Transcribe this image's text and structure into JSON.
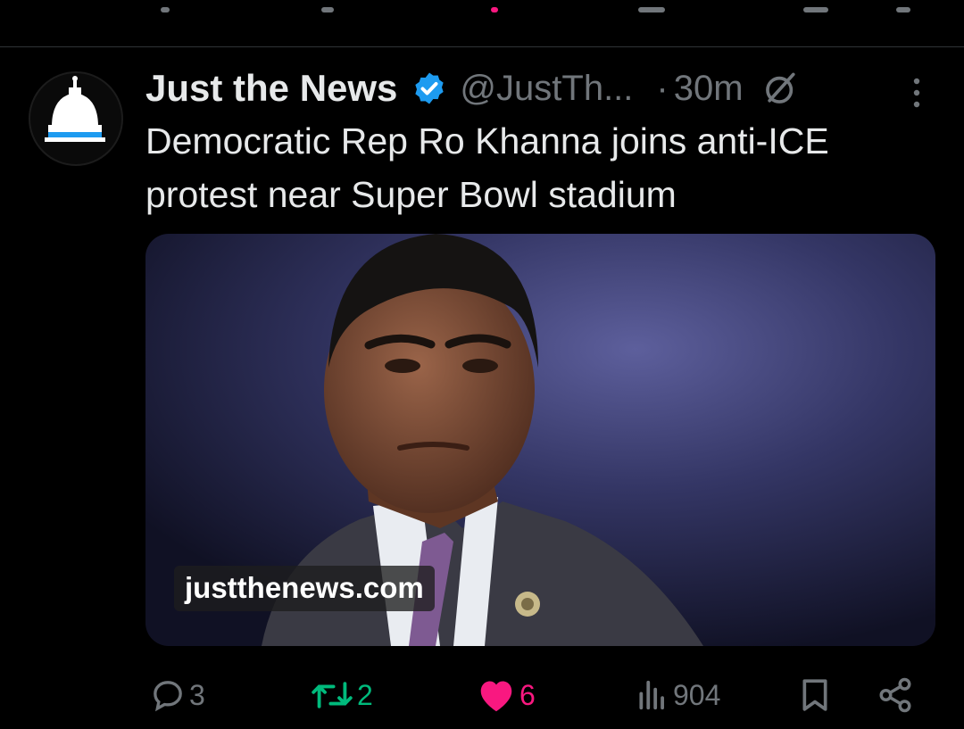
{
  "post": {
    "author_name": "Just the News",
    "handle": "@JustTh...",
    "separator": "·",
    "time_ago": "30m",
    "text": "Democratic Rep Ro Khanna joins anti-ICE protest near Super Bowl stadium",
    "link_source": "justthenews.com"
  },
  "actions": {
    "replies": "3",
    "reposts": "2",
    "likes": "6",
    "views": "904"
  },
  "colors": {
    "background": "#000000",
    "text": "#e7e9ea",
    "muted": "#71767b",
    "verified": "#1d9bf0",
    "repost": "#00ba7c",
    "like": "#f91880"
  },
  "icons": [
    "capitol-dome-icon",
    "verified-badge-icon",
    "grok-icon",
    "more-icon",
    "reply-icon",
    "repost-icon",
    "heart-icon",
    "views-icon",
    "bookmark-icon",
    "share-icon"
  ]
}
